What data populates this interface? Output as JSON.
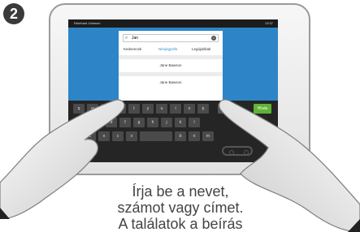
{
  "step_badge": "2",
  "status": {
    "user_name": "Reinhard Johnson",
    "time": "13:37"
  },
  "dialog": {
    "search_value": "Jan",
    "tabs": [
      {
        "label": "Kedvencek",
        "active": false
      },
      {
        "label": "Névjegyzék",
        "active": true
      },
      {
        "label": "Legújabbak",
        "active": false
      }
    ],
    "results": [
      "Jane Bawson",
      "Jane Bawson"
    ]
  },
  "keyboard": {
    "row1": [
      "q",
      "w",
      "e",
      "r",
      "t",
      "y",
      "u",
      "i",
      "o",
      "p"
    ],
    "row2": [
      "a",
      "s",
      "d",
      "f",
      "g",
      "h",
      "j",
      "k",
      "l"
    ],
    "row3": [
      "z",
      "x",
      "c",
      "v",
      "b",
      "n",
      "m"
    ],
    "action_label": "Hívás"
  },
  "caption": {
    "line1": "Írja be a nevet,",
    "line2": "számot vagy címet.",
    "line3": "A találatok a beírás"
  },
  "colors": {
    "screen_blue": "#2d85c7",
    "call_green": "#5fb336",
    "active_tab": "#2b8fd8"
  }
}
